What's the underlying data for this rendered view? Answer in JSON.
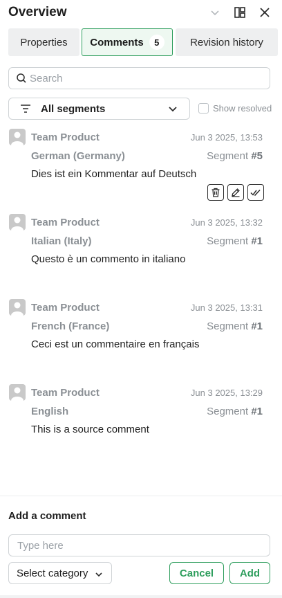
{
  "header": {
    "title": "Overview",
    "icons": [
      "chevron-down-icon",
      "layout-icon",
      "close-icon"
    ]
  },
  "tabs": [
    {
      "label": "Properties",
      "active": false
    },
    {
      "label": "Comments",
      "count": "5",
      "active": true
    },
    {
      "label": "Revision history",
      "active": false
    }
  ],
  "search": {
    "placeholder": "Search"
  },
  "filter": {
    "label": "All segments",
    "show_resolved_label": "Show resolved",
    "show_resolved_checked": false
  },
  "comments": [
    {
      "author": "Team Product",
      "time": "Jun 3 2025, 13:53",
      "language": "German (Germany)",
      "segment_prefix": "Segment ",
      "segment_number": "#5",
      "text": "Dies ist ein Kommentar auf Deutsch"
    },
    {
      "author": "Team Product",
      "time": "Jun 3 2025, 13:32",
      "language": "Italian (Italy)",
      "segment_prefix": "Segment ",
      "segment_number": "#1",
      "text": "Questo è un commento in italiano"
    },
    {
      "author": "Team Product",
      "time": "Jun 3 2025, 13:31",
      "language": "French (France)",
      "segment_prefix": "Segment ",
      "segment_number": "#1",
      "text": "Ceci est un commentaire en français"
    },
    {
      "author": "Team Product",
      "time": "Jun 3 2025, 13:29",
      "language": "English",
      "segment_prefix": "Segment ",
      "segment_number": "#1",
      "text": "This is a source comment"
    }
  ],
  "comment_actions": [
    "trash-icon",
    "edit-icon",
    "resolve-icon"
  ],
  "add_comment": {
    "title": "Add a comment",
    "placeholder": "Type here",
    "category_label": "Select category",
    "cancel_label": "Cancel",
    "add_label": "Add"
  },
  "colors": {
    "accent": "#2e9e5d",
    "muted_text": "#8a8f94",
    "tab_bg": "#eeeff0"
  }
}
